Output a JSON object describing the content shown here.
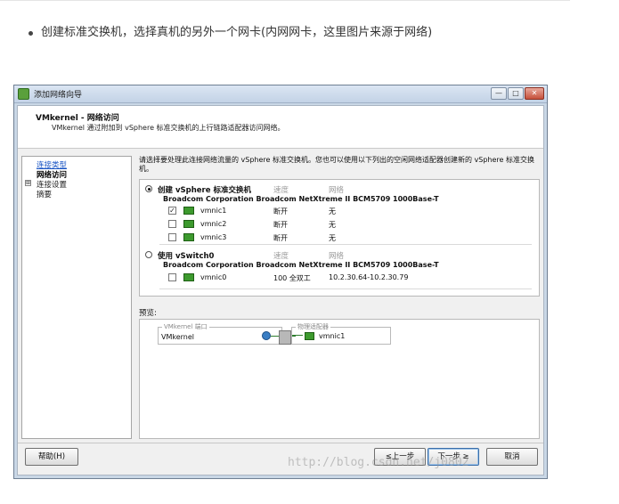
{
  "article": {
    "bullet_text": "创建标准交换机，选择真机的另外一个网卡(内网网卡，这里图片来源于网络)"
  },
  "window": {
    "title": "添加网络向导",
    "buttons": {
      "minimize": "—",
      "maximize": "□",
      "close": "✕"
    }
  },
  "header": {
    "title": "VMkernel - 网络访问",
    "subtitle": "VMkernel 通过附加到 vSphere 标准交换机的上行链路适配器访问网络。"
  },
  "nav": {
    "items": [
      {
        "label": "连接类型",
        "state": "link"
      },
      {
        "label": "网络访问",
        "state": "current"
      },
      {
        "label": "连接设置",
        "state": "plain",
        "expander": "⊞"
      },
      {
        "label": "摘要",
        "state": "plain"
      }
    ]
  },
  "content": {
    "instruction": "请选择要处理此连接网络流量的 vSphere 标准交换机。您也可以使用以下列出的空闲网络适配器创建新的 vSphere 标准交换机。",
    "columns": {
      "speed": "速度",
      "network": "网络"
    },
    "option_create": {
      "label": "创建 vSphere 标准交换机",
      "selected": true,
      "adapter": "Broadcom Corporation Broadcom NetXtreme II BCM5709 1000Base-T",
      "nics": [
        {
          "name": "vmnic1",
          "speed": "断开",
          "network": "无",
          "checked": true,
          "check_glyph": "✓"
        },
        {
          "name": "vmnic2",
          "speed": "断开",
          "network": "无",
          "checked": false,
          "check_glyph": ""
        },
        {
          "name": "vmnic3",
          "speed": "断开",
          "network": "无",
          "checked": false,
          "check_glyph": ""
        }
      ]
    },
    "option_existing": {
      "label": "使用 vSwitch0",
      "selected": false,
      "adapter": "Broadcom Corporation Broadcom NetXtreme II BCM5709 1000Base-T",
      "nics": [
        {
          "name": "vmnic0",
          "speed": "100 全双工",
          "network": "10.2.30.64-10.2.30.79",
          "checked": false,
          "check_glyph": ""
        }
      ]
    }
  },
  "preview": {
    "label": "预览:",
    "port_group_legend": "VMkernel 端口",
    "port_name": "VMkernel",
    "adapter_legend": "物理适配器",
    "adapter_nic": "vmnic1"
  },
  "footer": {
    "help": "帮助(H)",
    "back": "≤上一步",
    "next": "下一步 ≥",
    "cancel": "取消"
  },
  "watermark": "http://blog.csdn.net/j0802"
}
